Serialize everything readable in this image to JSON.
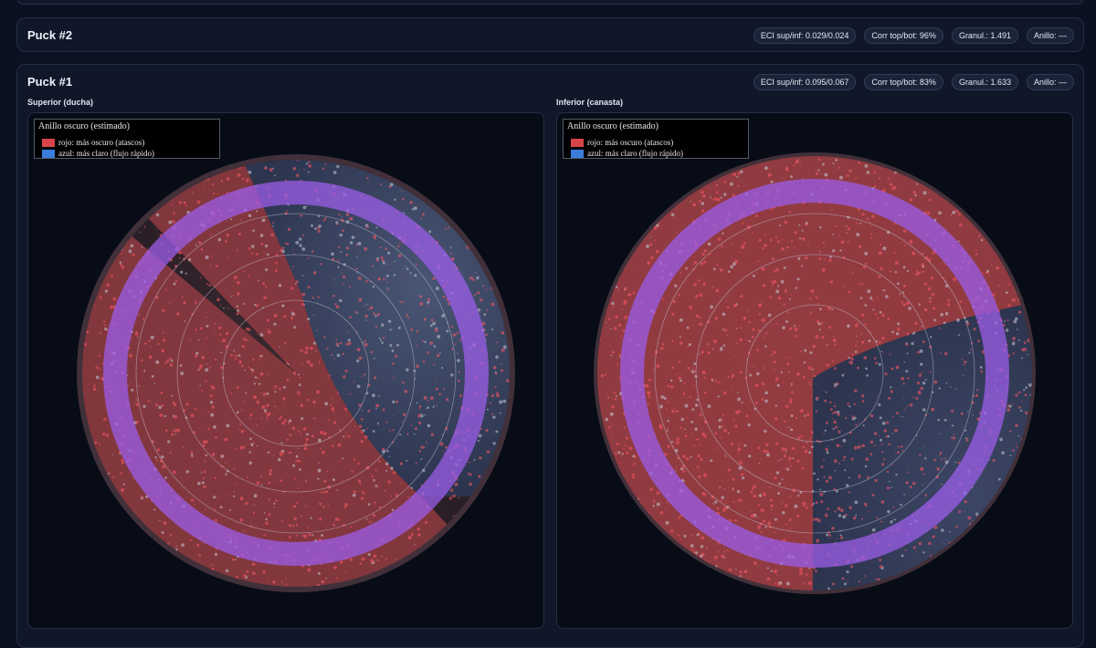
{
  "puck2": {
    "title": "Puck #2",
    "badges": [
      "ECI sup/inf: 0.029/0.024",
      "Corr top/bot: 96%",
      "Granul.: 1.491",
      "Anillo: —"
    ]
  },
  "puck1": {
    "title": "Puck #1",
    "badges": [
      "ECI sup/inf: 0.095/0.067",
      "Corr top/bot: 83%",
      "Granul.: 1.633",
      "Anillo: —"
    ],
    "panels": [
      {
        "label": "Superior (ducha)",
        "legend": {
          "title": "Anillo oscuro (estimado)",
          "items": [
            "rojo: más oscuro (atascos)",
            "azul: más claro (flujo rápido)"
          ]
        }
      },
      {
        "label": "Inferior (canasta)",
        "legend": {
          "title": "Anillo oscuro (estimado)",
          "items": [
            "rojo: más oscuro (atascos)",
            "azul: más claro (flujo rápido)"
          ]
        }
      }
    ]
  },
  "colors": {
    "dark_red": "#d9444a",
    "light_blue": "#3b7ddd",
    "ring_purple": "#8a5cd8"
  }
}
